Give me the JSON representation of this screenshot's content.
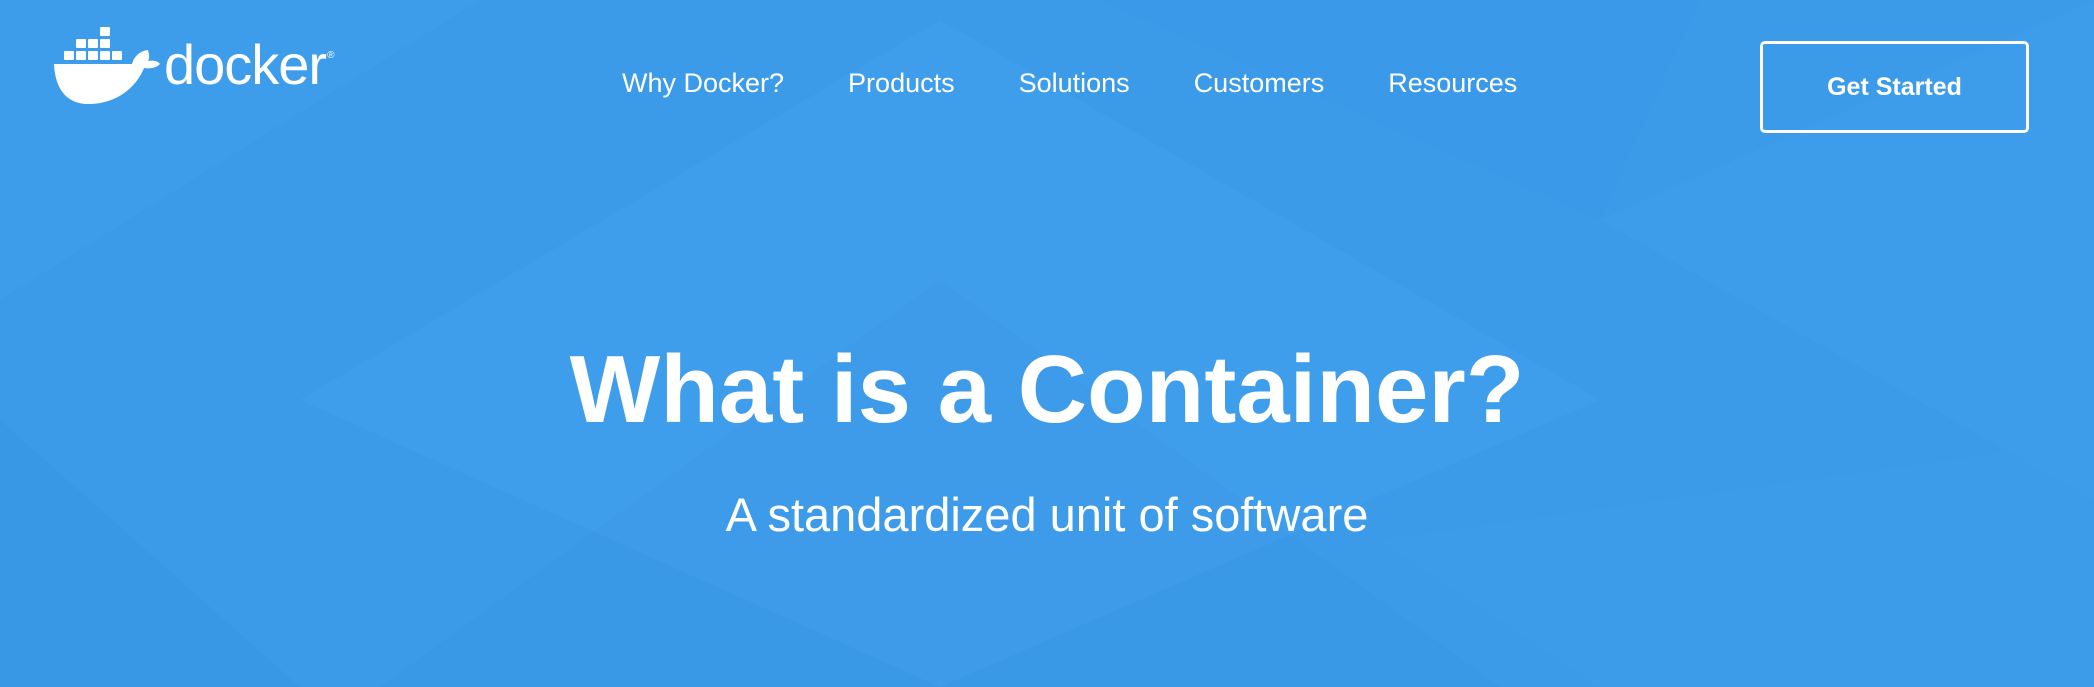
{
  "brand": {
    "name": "docker",
    "registered_mark": "®"
  },
  "header": {
    "nav": [
      {
        "label": "Why Docker?"
      },
      {
        "label": "Products"
      },
      {
        "label": "Solutions"
      },
      {
        "label": "Customers"
      },
      {
        "label": "Resources"
      }
    ],
    "cta_label": "Get Started"
  },
  "hero": {
    "title": "What is a Container?",
    "subtitle": "A standardized unit of software"
  },
  "colors": {
    "background": "#3b9be9",
    "text": "#ffffff"
  },
  "icons": {
    "logo": "docker-whale-icon"
  }
}
